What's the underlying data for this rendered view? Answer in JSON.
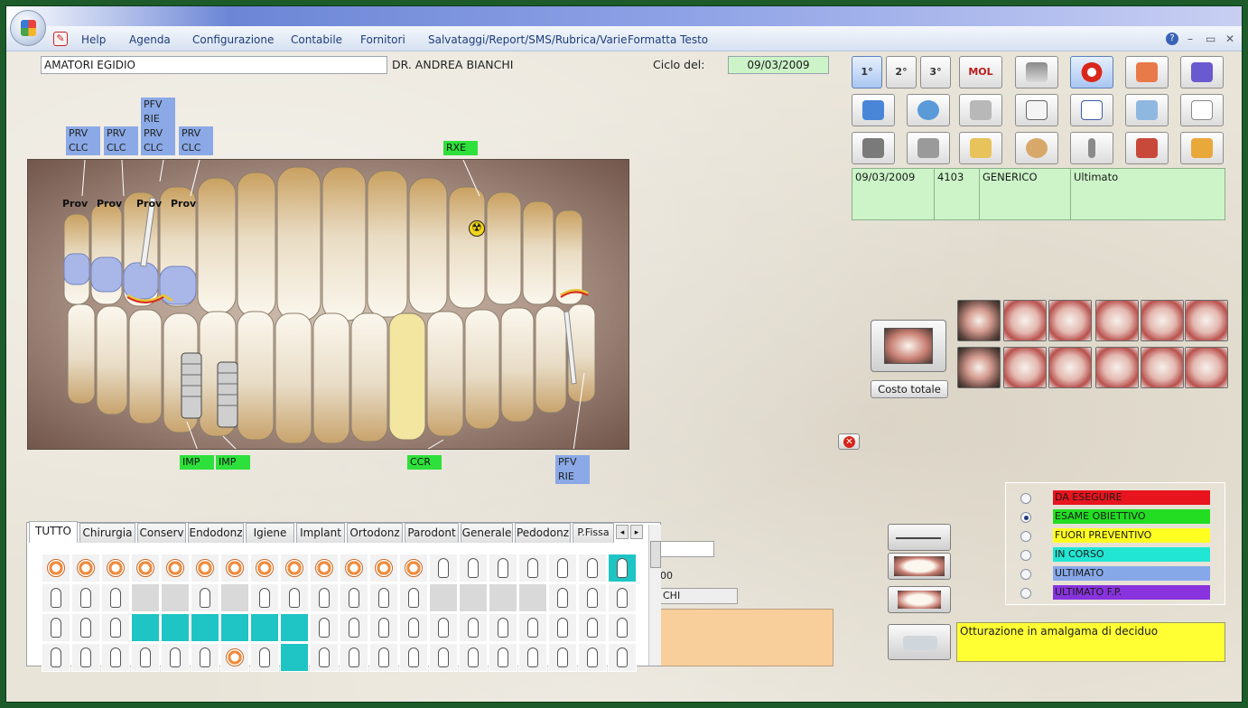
{
  "menu": {
    "items": [
      "Help",
      "Agenda",
      "Configurazione",
      "Contabile",
      "Fornitori",
      "Salvataggi/Report/SMS/Rubrica/Varie",
      "Formatta Testo"
    ],
    "help_icon": "?",
    "minimize": "–",
    "restore": "▭",
    "close": "✕"
  },
  "patient": {
    "name": "AMATORI EGIDIO",
    "doctor": "DR. ANDREA BIANCHI",
    "cycle_label": "Ciclo del:",
    "cycle_date": "09/03/2009"
  },
  "toolbar": {
    "row1": [
      "1°",
      "2°",
      "3°",
      "MOL",
      "",
      "",
      "",
      ""
    ],
    "row2": [
      "",
      "",
      "",
      "",
      "",
      "",
      "",
      ""
    ],
    "row3": [
      "",
      "",
      "",
      "",
      "",
      "",
      ""
    ],
    "icons": [
      "first-visit",
      "second-visit",
      "third-visit",
      "mol",
      "implant-screw",
      "lifebuoy",
      "dental-arch",
      "wizard",
      "monitor",
      "clock",
      "impression-tray",
      "tooth",
      "checklist",
      "book",
      "document",
      "handpiece",
      "camera",
      "clipboard",
      "panoramic-xray",
      "implant-post",
      "mouth-photo",
      "exit-door"
    ]
  },
  "visits": {
    "date": "09/03/2009",
    "code": "4103",
    "type": "GENERICO",
    "status": "Ultimato"
  },
  "tooth_tags": {
    "upper": [
      {
        "lines": [
          "PRV",
          "CLC"
        ]
      },
      {
        "lines": [
          "PRV",
          "CLC"
        ]
      },
      {
        "lines": [
          "PFV",
          "RIE",
          "PRV",
          "CLC"
        ]
      },
      {
        "lines": [
          "PRV",
          "CLC"
        ]
      },
      {
        "lines": [
          "RXE"
        ]
      }
    ],
    "lower": [
      {
        "lines": [
          "IMP"
        ]
      },
      {
        "lines": [
          "IMP"
        ]
      },
      {
        "lines": [
          "CCR"
        ]
      },
      {
        "lines": [
          "PFV",
          "RIE"
        ]
      }
    ],
    "prov_labels": [
      "Prov",
      "Prov",
      "Prov",
      "Prov"
    ],
    "radiation_symbol": "☢"
  },
  "cost_button": "Costo totale",
  "close_icon": "✕",
  "legend": [
    {
      "label": "DA ESEGUIRE",
      "color": "#e8141e",
      "selected": false
    },
    {
      "label": "ESAME OBIETTIVO",
      "color": "#22dd22",
      "selected": true
    },
    {
      "label": "FUORI PREVENTIVO",
      "color": "#ffff22",
      "selected": false
    },
    {
      "label": "IN CORSO",
      "color": "#22e6d4",
      "selected": false
    },
    {
      "label": "ULTIMATO",
      "color": "#86a8e8",
      "selected": false
    },
    {
      "label": "ULTIMATO F.P.",
      "color": "#8833dd",
      "selected": false
    }
  ],
  "description": "Otturazione in amalgama di deciduo",
  "tabs": [
    "TUTTO",
    "Chirurgia",
    "Conserv",
    "Endodonz",
    "Igiene",
    "Implant",
    "Ortodonz",
    "Parodont",
    "Generale",
    "Pedodonz",
    "P.Fissa"
  ],
  "tab_scroll": [
    "◂",
    "▸"
  ],
  "side_fields": {
    "field1": "",
    "field2": "00",
    "field3": "CHI"
  }
}
